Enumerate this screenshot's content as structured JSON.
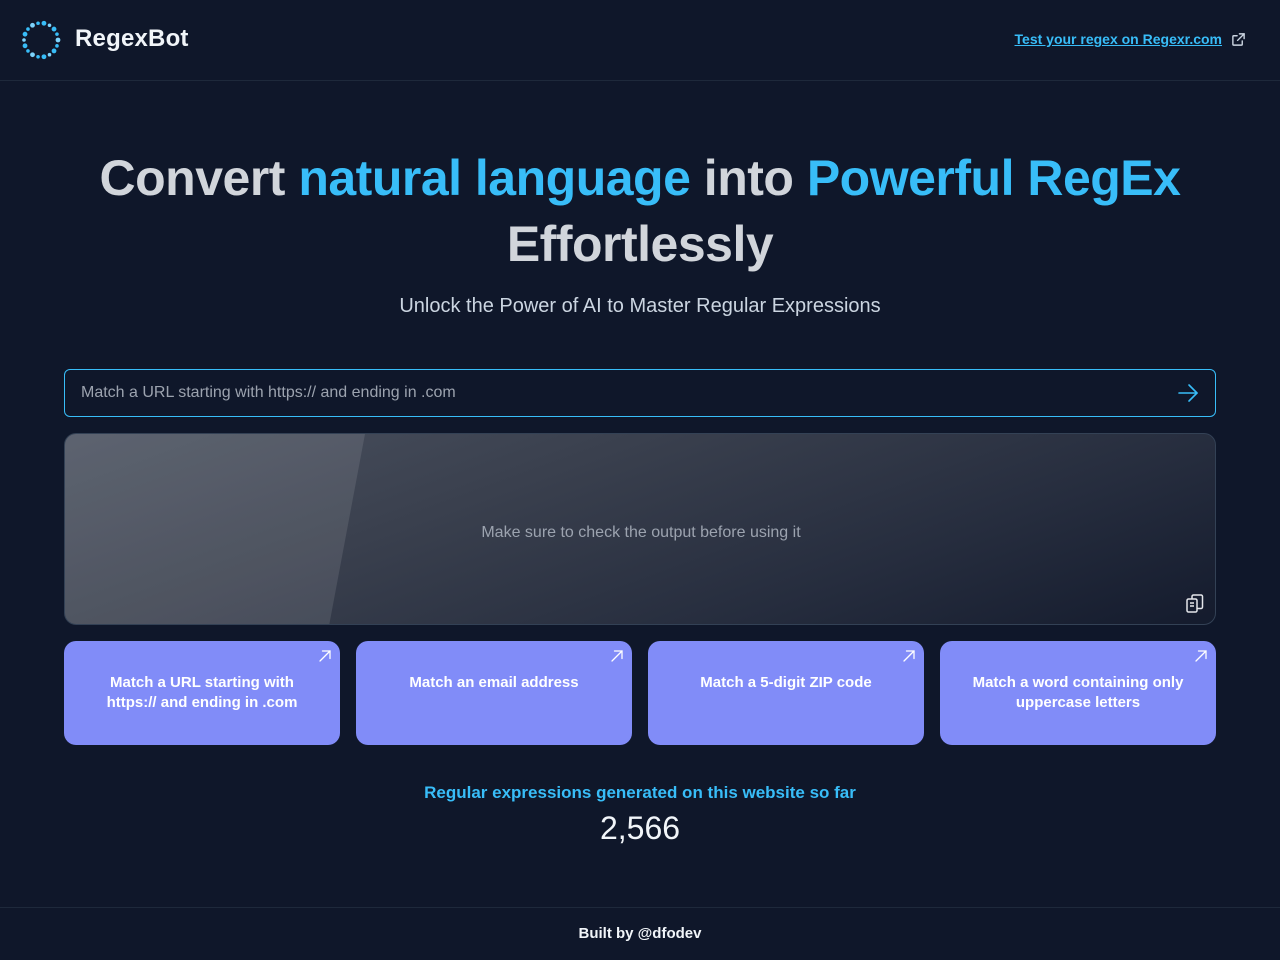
{
  "header": {
    "app_title": "RegexBot",
    "logo_icon": "dotted-ring-logo",
    "external_link_label": "Test your regex on Regexr.com",
    "external_link_icon": "external-link-icon"
  },
  "hero": {
    "headline_part1": "Convert ",
    "headline_accent1": "natural language",
    "headline_part2": " into ",
    "headline_accent2": "Powerful RegEx",
    "headline_part3": "Effortlessly",
    "subtitle": "Unlock the Power of AI to Master Regular Expressions"
  },
  "prompt": {
    "placeholder": "Match a URL starting with https:// and ending in .com",
    "value": "",
    "submit_icon": "arrow-right-icon"
  },
  "output": {
    "text": "Make sure to check the output before using it",
    "copy_icon": "clipboard-icon"
  },
  "examples": [
    {
      "label": "Match a URL starting with https:// and ending in .com",
      "icon": "arrow-up-right-icon"
    },
    {
      "label": "Match an email address",
      "icon": "arrow-up-right-icon"
    },
    {
      "label": "Match a 5-digit ZIP code",
      "icon": "arrow-up-right-icon"
    },
    {
      "label": "Match a word containing only uppercase letters",
      "icon": "arrow-up-right-icon"
    }
  ],
  "stats": {
    "label": "Regular expressions generated on this website so far",
    "count": "2,566"
  },
  "footer": {
    "text": "Built by @dfodev"
  },
  "colors": {
    "background": "#0f172a",
    "accent": "#38bdf8",
    "card": "#818cf8",
    "text": "#d1d5db"
  }
}
